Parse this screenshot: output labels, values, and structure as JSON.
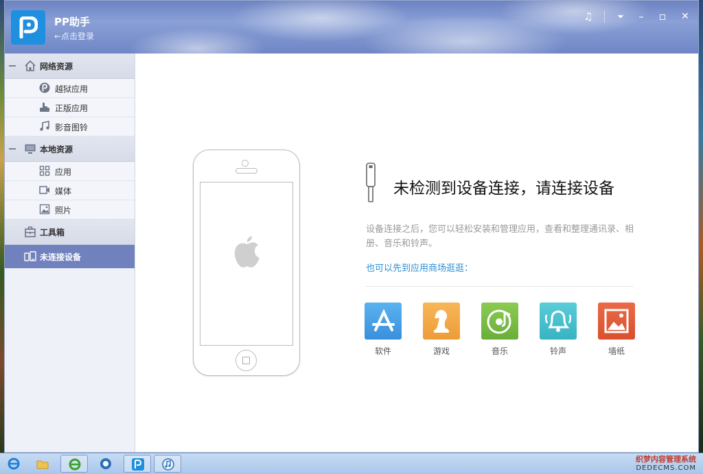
{
  "app": {
    "title": "PP助手",
    "login_text": "←点击登录"
  },
  "titlebar_buttons": [
    {
      "name": "music-icon",
      "glyph": "♫"
    },
    {
      "name": "menu-icon",
      "glyph": "⏷"
    },
    {
      "name": "minimize-icon",
      "glyph": "–"
    },
    {
      "name": "maximize-icon",
      "glyph": "▫"
    },
    {
      "name": "close-icon",
      "glyph": "✕"
    }
  ],
  "sidebar": {
    "groups": [
      {
        "label": "网络资源",
        "icon": "home-icon",
        "items": [
          {
            "label": "越狱应用",
            "icon": "pp-icon"
          },
          {
            "label": "正版应用",
            "icon": "appstore-hand-icon"
          },
          {
            "label": "影音图铃",
            "icon": "music-note-icon"
          }
        ]
      },
      {
        "label": "本地资源",
        "icon": "monitor-icon",
        "items": [
          {
            "label": "应用",
            "icon": "grid-icon"
          },
          {
            "label": "媒体",
            "icon": "video-icon"
          },
          {
            "label": "照片",
            "icon": "photo-icon"
          }
        ]
      }
    ],
    "toolbox": {
      "label": "工具箱",
      "icon": "toolbox-icon"
    },
    "device": {
      "label": "未连接设备",
      "icon": "device-icon"
    }
  },
  "main": {
    "headline": "未检测到设备连接，请连接设备",
    "description": "设备连接之后，您可以轻松安装和管理应用，查看和整理通讯录、相册、音乐和铃声。",
    "store_link": "也可以先到应用商场逛逛：",
    "categories": [
      {
        "label": "软件",
        "icon": "software-icon",
        "color": "#4aa3e8"
      },
      {
        "label": "游戏",
        "icon": "game-icon",
        "color": "#f2a94a"
      },
      {
        "label": "音乐",
        "icon": "music-disc-icon",
        "color": "#7ec04a"
      },
      {
        "label": "铃声",
        "icon": "bell-icon",
        "color": "#4bc4d0"
      },
      {
        "label": "墙纸",
        "icon": "wallpaper-icon",
        "color": "#e35a3c"
      }
    ]
  },
  "watermark": {
    "line1": "织梦内容管理系统",
    "line2": "DEDECMS.COM"
  }
}
